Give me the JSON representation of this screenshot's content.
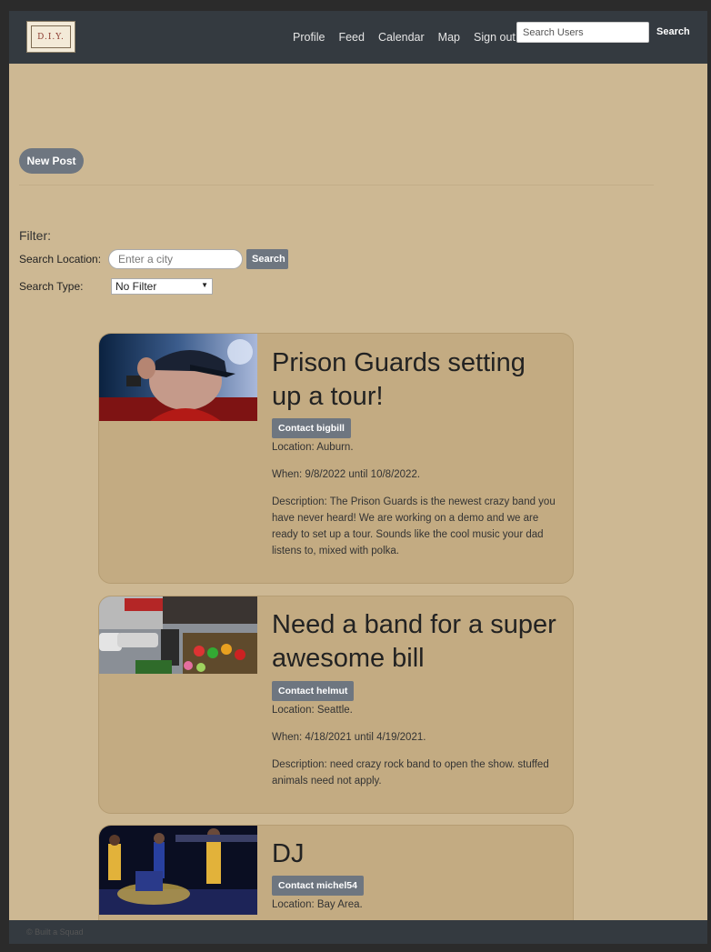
{
  "brand": {
    "logo_text": "D.I.Y."
  },
  "nav": {
    "links": [
      "Profile",
      "Feed",
      "Calendar",
      "Map",
      "Sign out"
    ],
    "search_placeholder": "Search Users",
    "search_label": "Search"
  },
  "actions": {
    "new_post_label": "New Post"
  },
  "filter": {
    "title": "Filter:",
    "location_label": "Search Location:",
    "location_placeholder": "Enter a city",
    "location_button": "Search",
    "type_label": "Search Type:",
    "type_selected": "No Filter"
  },
  "posts": [
    {
      "title": "Prison Guards setting up a tour!",
      "contact": "Contact bigbill",
      "location": "Location: Auburn.",
      "when": "When: 9/8/2022 until 10/8/2022.",
      "description": "Description: The Prison Guards is the newest crazy band you have never heard! We are working on a demo and we are ready to set up a tour. Sounds like the cool music your dad listens to, mixed with polka."
    },
    {
      "title": "Need a band for a super awesome bill",
      "contact": "Contact helmut",
      "location": "Location: Seattle.",
      "when": "When: 4/18/2021 until 4/19/2021.",
      "description": "Description: need crazy rock band to open the show. stuffed animals need not apply."
    },
    {
      "title": "DJ",
      "contact": "Contact michel54",
      "location": "Location: Bay Area."
    }
  ],
  "footer": {
    "text": "© Built a Squad"
  }
}
